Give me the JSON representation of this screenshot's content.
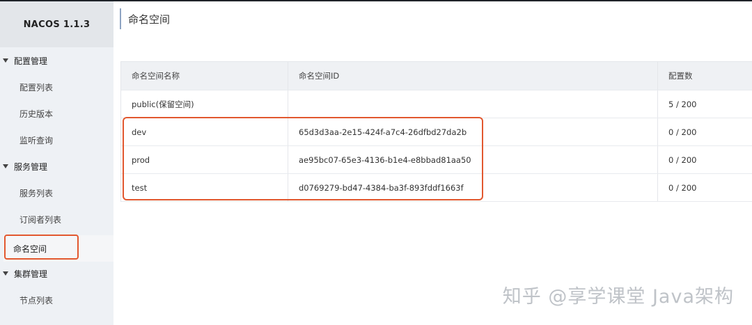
{
  "app": {
    "brand": "NACOS 1.1.3"
  },
  "sidebar": {
    "groups": [
      {
        "title": "配置管理",
        "items": [
          "配置列表",
          "历史版本",
          "监听查询"
        ]
      },
      {
        "title": "服务管理",
        "items": [
          "服务列表",
          "订阅者列表"
        ]
      },
      {
        "title": "集群管理",
        "items": [
          "节点列表"
        ]
      }
    ],
    "active_item": "命名空间"
  },
  "main": {
    "page_title": "命名空间",
    "table": {
      "columns": [
        "命名空间名称",
        "命名空间ID",
        "配置数"
      ],
      "rows": [
        {
          "name": "public(保留空间)",
          "id": "",
          "count": "5 / 200"
        },
        {
          "name": "dev",
          "id": "65d3d3aa-2e15-424f-a7c4-26dfbd27da2b",
          "count": "0 / 200"
        },
        {
          "name": "prod",
          "id": "ae95bc07-65e3-4136-b1e4-e8bbad81aa50",
          "count": "0 / 200"
        },
        {
          "name": "test",
          "id": "d0769279-bd47-4384-ba3f-893fddf1663f",
          "count": "0 / 200"
        }
      ]
    }
  },
  "watermark": "知乎 @享学课堂 Java架构",
  "colors": {
    "annotation": "#e2582f",
    "sidebar_bg": "#eef1f5",
    "header_bg": "#eff1f4"
  }
}
